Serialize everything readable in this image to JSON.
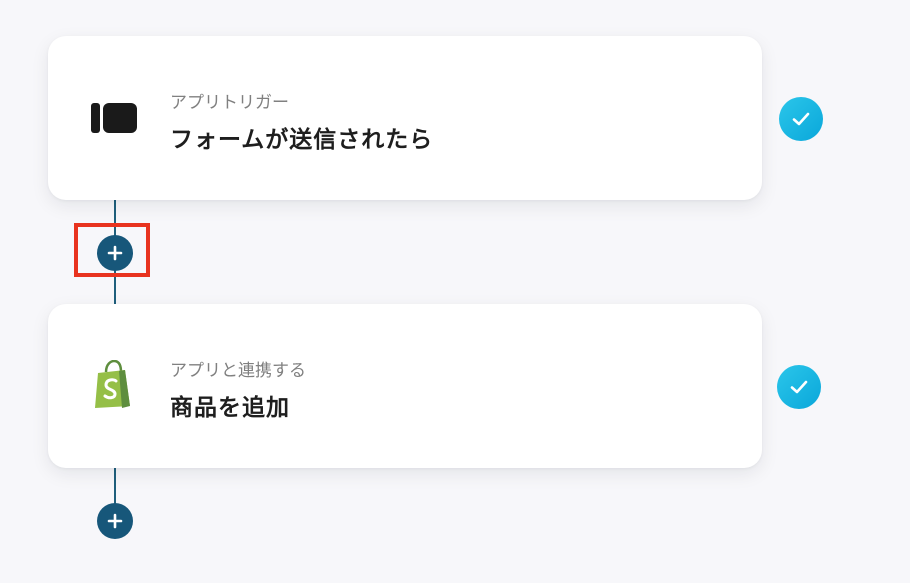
{
  "flow": {
    "steps": [
      {
        "subtitle": "アプリトリガー",
        "title": "フォームが送信されたら",
        "icon": "form-app-icon",
        "status_icon": "check-icon"
      },
      {
        "subtitle": "アプリと連携する",
        "title": "商品を追加",
        "icon": "shopify-icon",
        "status_icon": "check-icon"
      }
    ],
    "add_button_icon": "plus-icon"
  },
  "colors": {
    "background": "#f7f7fa",
    "connector": "#1f5f7c",
    "add_button": "#17577a",
    "check": "#16b3e2",
    "highlight": "#e8331f",
    "shopify_bag": "#95bf47"
  }
}
